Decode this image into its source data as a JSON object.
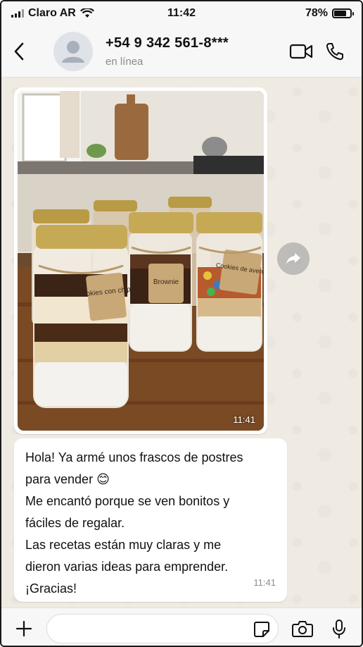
{
  "status_bar": {
    "carrier": "Claro AR",
    "time": "11:42",
    "battery": "78%",
    "battery_level": 0.78
  },
  "header": {
    "contact_name": "+54 9 342 561-8***",
    "contact_status": "en línea",
    "icons": {
      "back": "chevron-left-icon",
      "avatar": "default-avatar-icon",
      "video": "video-camera-icon",
      "call": "phone-icon"
    }
  },
  "messages": [
    {
      "type": "image",
      "time": "11:41",
      "image_labels": [
        "Cookies con chips",
        "Brownie",
        "Cookies de avena"
      ]
    },
    {
      "type": "text",
      "lines": [
        "Hola! Ya armé unos frascos de postres",
        "para vender 😊",
        "Me encantó porque se ven bonitos y",
        "fáciles de regalar.",
        "Las recetas están muy claras y me",
        "dieron varias ideas para emprender.",
        "¡Gracias!"
      ],
      "time": "11:41"
    }
  ],
  "input_bar": {
    "placeholder": "",
    "icons": {
      "add": "plus-icon",
      "sticker": "sticker-icon",
      "camera": "camera-icon",
      "mic": "microphone-icon"
    }
  },
  "colors": {
    "chat_background": "#efeae2",
    "bubble": "#ffffff",
    "accent": "#111111"
  }
}
